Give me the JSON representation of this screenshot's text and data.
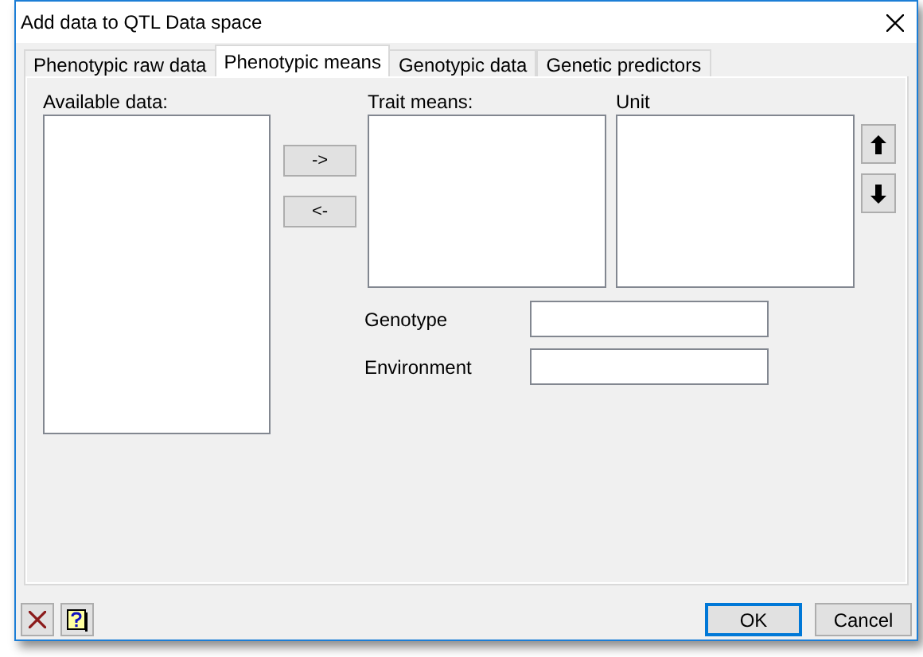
{
  "window": {
    "title": "Add data to QTL Data space"
  },
  "tabs": [
    {
      "label": "Phenotypic raw data",
      "selected": false
    },
    {
      "label": "Phenotypic means",
      "selected": true
    },
    {
      "label": "Genotypic data",
      "selected": false
    },
    {
      "label": "Genetic predictors",
      "selected": false
    }
  ],
  "available_data": {
    "label": "Available data:"
  },
  "move_buttons": [
    "->",
    "<-"
  ],
  "trait_means": {
    "label": "Trait means:"
  },
  "unit": {
    "label": "Unit"
  },
  "fields": [
    {
      "label": "Genotype"
    },
    {
      "label": "Environment"
    }
  ],
  "buttons": [
    "OK",
    "Cancel"
  ]
}
